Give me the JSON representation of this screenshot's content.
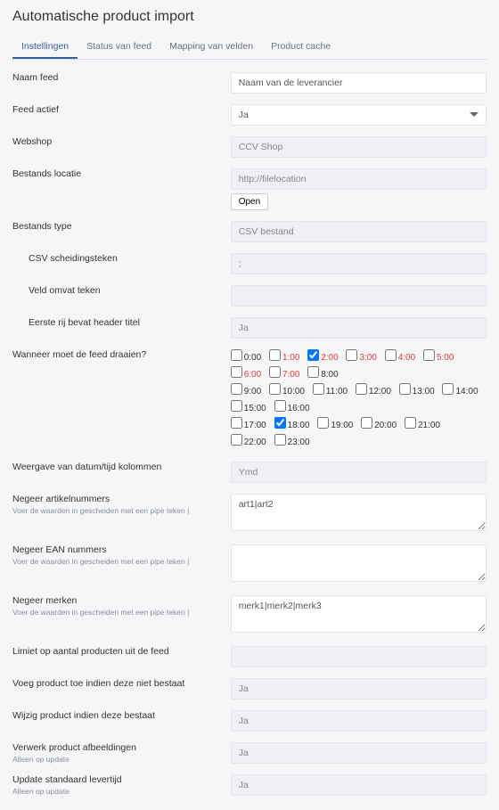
{
  "page_title": "Automatische product import",
  "tabs": [
    {
      "label": "Instellingen",
      "active": true
    },
    {
      "label": "Status van feed",
      "active": false
    },
    {
      "label": "Mapping van velden",
      "active": false
    },
    {
      "label": "Product cache",
      "active": false
    }
  ],
  "labels": {
    "naam_feed": "Naam feed",
    "feed_actief": "Feed actief",
    "webshop": "Webshop",
    "bestands_locatie": "Bestands locatie",
    "bestands_type": "Bestands type",
    "csv_scheiding": "CSV scheidingsteken",
    "veld_omvat": "Veld omvat teken",
    "eerste_rij": "Eerste rij bevat header titel",
    "wanneer": "Wanneer moet de feed draaien?",
    "datum_weer": "Weergave van datum/tijd kolommen",
    "negeer_artikel": "Negeer artikelnummers",
    "negeer_ean": "Negeer EAN nummers",
    "negeer_merk": "Negeer merken",
    "limiet": "Limiet op aantal producten uit de feed",
    "voeg_toe": "Voeg product toe indien deze niet bestaat",
    "wijzig": "Wijzig product indien deze bestaat",
    "verwerk_afb": "Verwerk product afbeeldingen",
    "update_levertijd": "Update standaard levertijd",
    "open_btn": "Open"
  },
  "sublabels": {
    "pipe_hint": "Voer de waarden in gescheiden met een pipe teken |",
    "update_only": "Alleen op update"
  },
  "values": {
    "naam_feed": "Naam van de leverancier",
    "feed_actief": "Ja",
    "webshop": "CCV Shop",
    "bestands_locatie": "http://filelocation",
    "bestands_type": "CSV bestand",
    "csv_scheiding": ";",
    "veld_omvat": "",
    "eerste_rij": "Ja",
    "datum_weer": "Ymd",
    "negeer_artikel": "art1|art2",
    "negeer_ean": "",
    "negeer_merk": "merk1|merk2|merk3",
    "limiet": "",
    "voeg_toe": "Ja",
    "wijzig": "Ja",
    "verwerk_afb": "Ja",
    "update_levertijd": "Ja"
  },
  "schedule": {
    "hours": [
      {
        "label": "0:00",
        "checked": false,
        "red": false
      },
      {
        "label": "1:00",
        "checked": false,
        "red": true
      },
      {
        "label": "2:00",
        "checked": true,
        "red": true
      },
      {
        "label": "3:00",
        "checked": false,
        "red": true
      },
      {
        "label": "4:00",
        "checked": false,
        "red": true
      },
      {
        "label": "5:00",
        "checked": false,
        "red": true
      },
      {
        "label": "6:00",
        "checked": false,
        "red": true
      },
      {
        "label": "7:00",
        "checked": false,
        "red": true
      },
      {
        "label": "8:00",
        "checked": false,
        "red": false
      },
      {
        "label": "9:00",
        "checked": false,
        "red": false
      },
      {
        "label": "10:00",
        "checked": false,
        "red": false
      },
      {
        "label": "11:00",
        "checked": false,
        "red": false
      },
      {
        "label": "12:00",
        "checked": false,
        "red": false
      },
      {
        "label": "13:00",
        "checked": false,
        "red": false
      },
      {
        "label": "14:00",
        "checked": false,
        "red": false
      },
      {
        "label": "15:00",
        "checked": false,
        "red": false
      },
      {
        "label": "16:00",
        "checked": false,
        "red": false
      },
      {
        "label": "17:00",
        "checked": false,
        "red": false
      },
      {
        "label": "18:00",
        "checked": true,
        "red": false
      },
      {
        "label": "19:00",
        "checked": false,
        "red": false
      },
      {
        "label": "20:00",
        "checked": false,
        "red": false
      },
      {
        "label": "21:00",
        "checked": false,
        "red": false
      },
      {
        "label": "22:00",
        "checked": false,
        "red": false
      },
      {
        "label": "23:00",
        "checked": false,
        "red": false
      }
    ]
  }
}
